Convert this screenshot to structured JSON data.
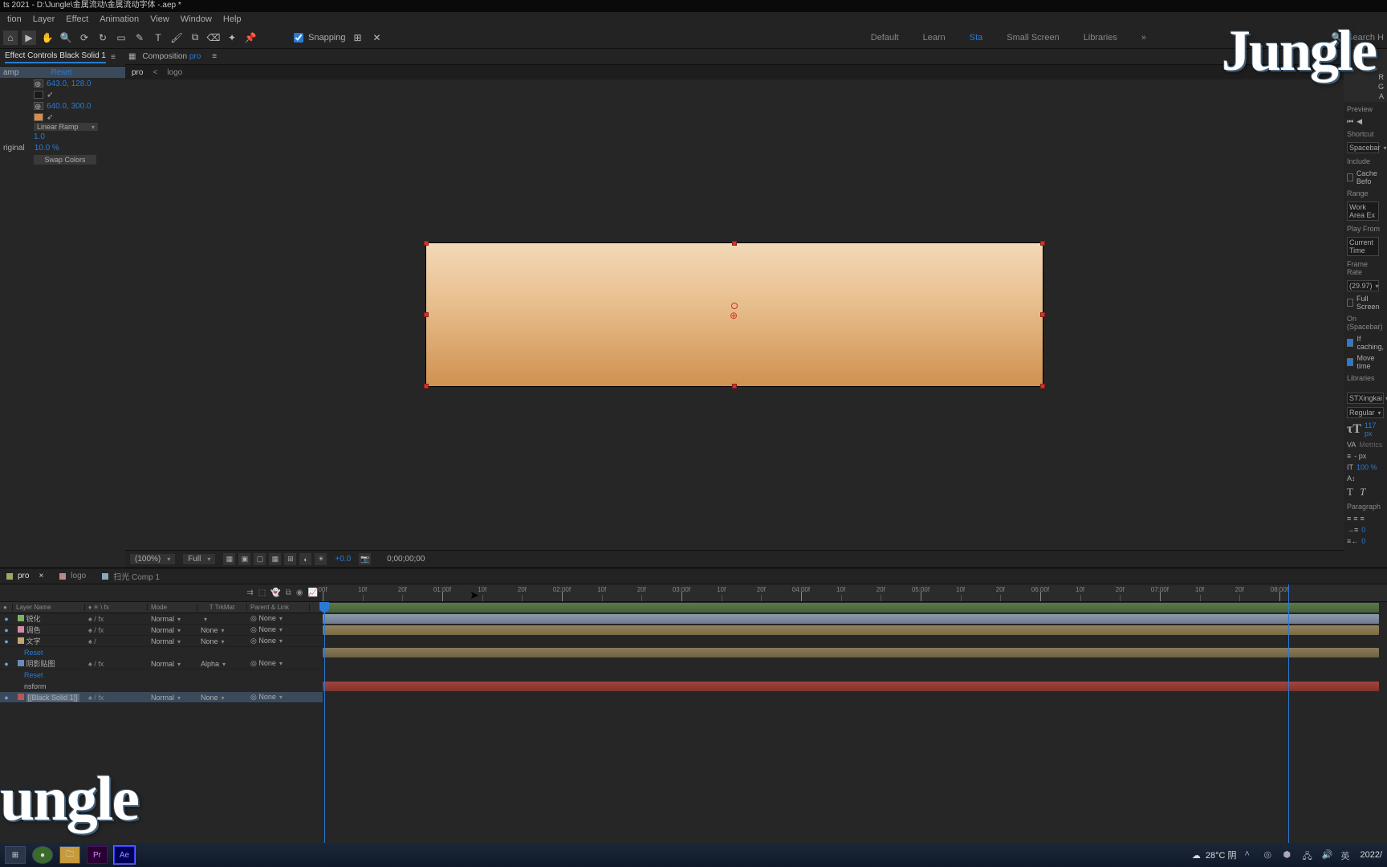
{
  "titlebar": "ts 2021 - D:\\Jungle\\金属流动\\金属流动字体 -.aep *",
  "menu": [
    "tion",
    "Layer",
    "Effect",
    "Animation",
    "View",
    "Window",
    "Help"
  ],
  "toolbar": {
    "icons": [
      "home-icon",
      "selection-icon",
      "hand-icon",
      "zoom-icon",
      "orbit-icon",
      "rotate-icon",
      "rect-icon",
      "pen-icon",
      "type-icon",
      "brush-icon",
      "clone-icon",
      "eraser-icon",
      "roto-icon",
      "puppet-icon"
    ],
    "snapping_label": "Snapping",
    "snap_icons": [
      "snap-edge-icon",
      "snap-center-icon"
    ],
    "workspaces": [
      "Default",
      "Learn",
      "Sta",
      "Small Screen",
      "Libraries"
    ],
    "search_placeholder": "Search H"
  },
  "effect_controls": {
    "tab_label": "Effect Controls",
    "layer_name": "Black Solid 1",
    "effect_name": "amp",
    "reset_label": "Reset",
    "start_point": "643.0, 128.0",
    "end_point": "640.0, 300.0",
    "ramp_type": "Linear Ramp",
    "scatter": "1.0",
    "blend_label": "riginal",
    "blend_value": "10.0 %",
    "swap_btn": "Swap Colors"
  },
  "viewer": {
    "panel_prefix": "Composition",
    "comp_name": "pro",
    "crumbs": [
      "pro",
      "<",
      "logo"
    ],
    "zoom": "(100%)",
    "resolution": "Full",
    "exposure": "+0.0",
    "timecode": "0;00;00;00"
  },
  "right_panel": {
    "swatch_labels": [
      "R",
      "G",
      "A"
    ],
    "preview": "Preview",
    "shortcut": "Shortcut",
    "spacebar": "Spacebar",
    "include": "Include",
    "cache": "Cache Befo",
    "range": "Range",
    "workarea": "Work Area Ex",
    "playfrom": "Play From",
    "current": "Current Time",
    "framerate": "Frame Rate",
    "fps": "(29.97)",
    "fullscreen": "Full Screen",
    "onspace": "On (Spacebar)",
    "ifcaching": "If caching,",
    "movetime": "Move time",
    "libraries": "Libraries",
    "font_family": "STXingkai",
    "font_style": "Regular",
    "font_size": "117",
    "font_size_suffix": " px",
    "tracking": "Metrics",
    "leading": "- px",
    "vscale": "100 %",
    "paragraph": "Paragraph"
  },
  "timeline": {
    "tabs": [
      {
        "label": "pro",
        "active": true
      },
      {
        "label": "logo",
        "active": false
      },
      {
        "label": "扫光 Comp 1",
        "active": false
      }
    ],
    "col_headers": {
      "name": "Layer Name",
      "switches": "♦ ✳ \\ fx",
      "mode": "Mode",
      "trk": "TrkMat",
      "parent": "Parent & Link"
    },
    "layers": [
      {
        "vis": "●",
        "color": "clr-green",
        "name": "锐化",
        "sw": "♠  /  fx",
        "mode": "Normal",
        "trk": "",
        "parent": "None"
      },
      {
        "vis": "●",
        "color": "clr-pink",
        "name": "调色",
        "sw": "♠  /  fx",
        "mode": "Normal",
        "trk": "None",
        "parent": "None"
      },
      {
        "vis": "●",
        "color": "clr-tan",
        "name": "文字",
        "sw": "♠  /",
        "mode": "Normal",
        "trk": "None",
        "parent": "None"
      },
      {
        "vis": "●",
        "color": "clr-blue",
        "name": "阴影贴图",
        "sw": "♠  /  fx",
        "mode": "Normal",
        "trk": "Alpha",
        "parent": "None"
      },
      {
        "vis": "●",
        "color": "clr-red",
        "name": "[Black Solid 1]",
        "sw": "♠  /  fx",
        "mode": "Normal",
        "trk": "None",
        "parent": "None",
        "selected": true
      }
    ],
    "prop_reset": "Reset",
    "prop_transform": "nsform",
    "ruler_majors": [
      "00f",
      "01:00f",
      "02:00f",
      "03:00f",
      "04:00f",
      "05:00f",
      "06:00f",
      "07:00f",
      "08:00f"
    ],
    "ruler_minors": [
      "10f",
      "20f"
    ]
  },
  "taskbar": {
    "apps": [
      "task-view-icon",
      "wechat-icon",
      "explorer-icon",
      "Pr",
      "Ae"
    ],
    "weather": "28°C 阴",
    "date": "2022/"
  },
  "watermark": "Jungle",
  "watermark2": "ungle"
}
